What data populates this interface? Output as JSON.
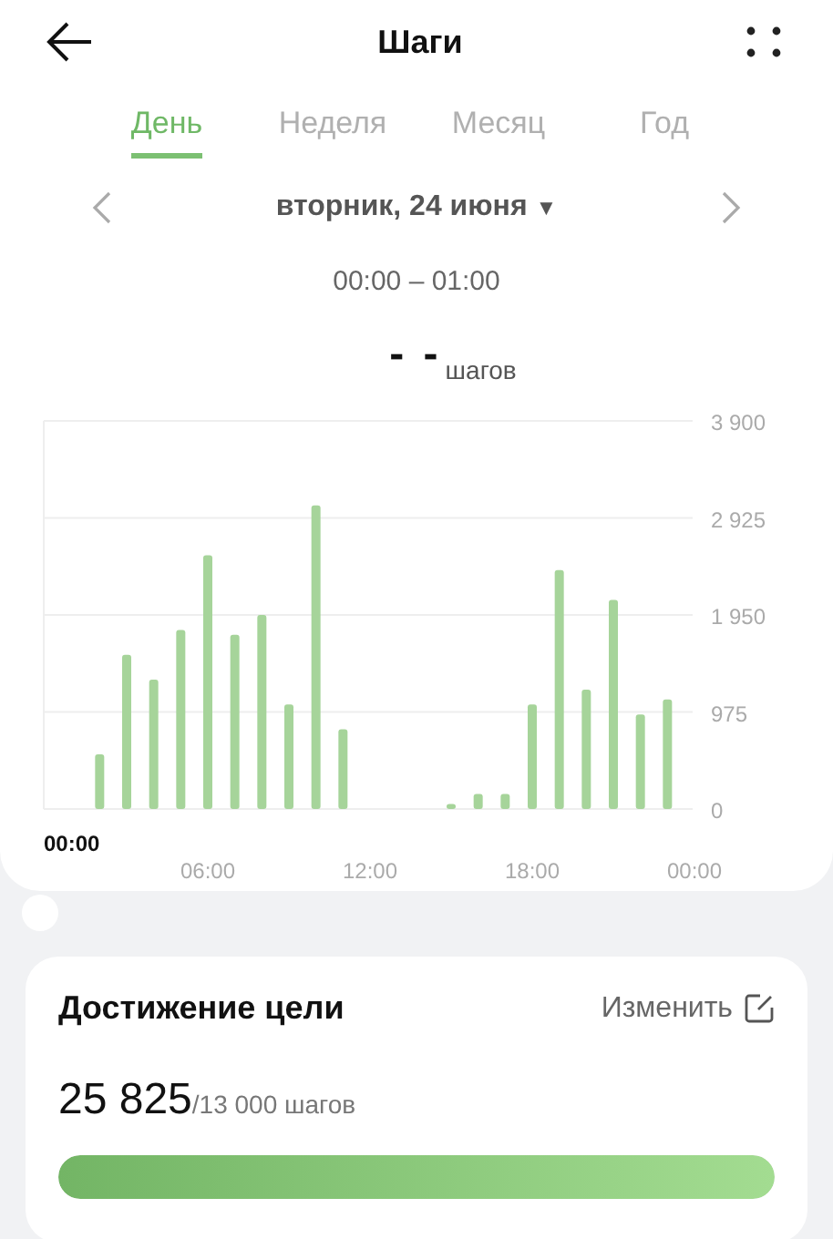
{
  "header": {
    "title": "Шаги"
  },
  "tabs": [
    {
      "label": "День",
      "selected": true
    },
    {
      "label": "Неделя",
      "selected": false
    },
    {
      "label": "Месяц",
      "selected": false
    },
    {
      "label": "Год",
      "selected": false
    }
  ],
  "date": {
    "label": "вторник, 24 июня",
    "caret": "▼"
  },
  "time_range": "00:00 – 01:00",
  "reading": {
    "value": "- -",
    "unit": "шагов"
  },
  "chart": {
    "selected_label": "00:00",
    "time_labels": [
      "06:00",
      "12:00",
      "18:00",
      "00:00"
    ],
    "chart_data": {
      "type": "bar",
      "grid": true,
      "series": [
        {
          "color": "#a6d49a",
          "values": [
            null,
            null,
            550,
            1550,
            1300,
            1800,
            2550,
            1750,
            1950,
            1050,
            3050,
            800,
            null,
            null,
            null,
            50,
            150,
            150,
            1050,
            2400,
            1200,
            2100,
            950,
            1100
          ]
        }
      ],
      "ylim": [
        0,
        3900
      ],
      "yticks": [
        {
          "value": 0,
          "label": "0"
        },
        {
          "value": 975,
          "label": "975"
        },
        {
          "value": 1950,
          "label": "1 950"
        },
        {
          "value": 2925,
          "label": "2 925"
        },
        {
          "value": 3900,
          "label": "3 900"
        }
      ]
    }
  },
  "goal": {
    "title": "Достижение цели",
    "edit_label": "Изменить",
    "steps": "25 825",
    "target": "/13 000 шагов",
    "level": 1
  }
}
